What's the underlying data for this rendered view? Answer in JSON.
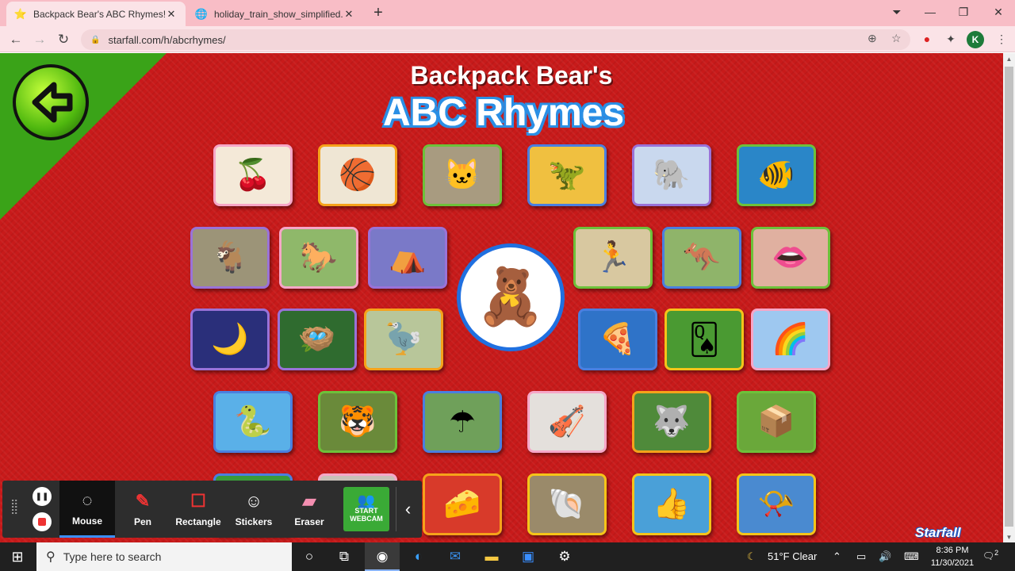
{
  "browser": {
    "tabs": [
      {
        "title": "Backpack Bear's ABC Rhymes!",
        "favicon": "star-icon",
        "active": true
      },
      {
        "title": "holiday_train_show_simplified.pd",
        "favicon": "globe-icon",
        "active": false
      }
    ],
    "url": "starfall.com/h/abcrhymes/",
    "profile_initial": "K"
  },
  "page": {
    "title_line1": "Backpack Bear's",
    "title_line2": "ABC Rhymes",
    "brand": "Starfall",
    "tiles": [
      {
        "name": "apples",
        "glyph": "🍒"
      },
      {
        "name": "ball",
        "glyph": "🏀"
      },
      {
        "name": "cat",
        "glyph": "🐱"
      },
      {
        "name": "dinosaur",
        "glyph": "🦖"
      },
      {
        "name": "elephant",
        "glyph": "🐘"
      },
      {
        "name": "fish",
        "glyph": "🐠"
      },
      {
        "name": "goat",
        "glyph": "🐐"
      },
      {
        "name": "horse",
        "glyph": "🐎"
      },
      {
        "name": "igloo",
        "glyph": "⛺"
      },
      {
        "name": "jump-rope",
        "glyph": "🏃"
      },
      {
        "name": "kangaroo",
        "glyph": "🦘"
      },
      {
        "name": "lips",
        "glyph": "👄"
      },
      {
        "name": "moon",
        "glyph": "🌙"
      },
      {
        "name": "nest",
        "glyph": "🪺"
      },
      {
        "name": "ostrich",
        "glyph": "🦤"
      },
      {
        "name": "pizza",
        "glyph": "🍕"
      },
      {
        "name": "queen",
        "glyph": "🂭"
      },
      {
        "name": "rainbow",
        "glyph": "🌈"
      },
      {
        "name": "snake",
        "glyph": "🐍"
      },
      {
        "name": "tiger",
        "glyph": "🐯"
      },
      {
        "name": "umbrella",
        "glyph": "☂"
      },
      {
        "name": "violin",
        "glyph": "🎻"
      },
      {
        "name": "wolf",
        "glyph": "🐺"
      },
      {
        "name": "box",
        "glyph": "📦"
      },
      {
        "name": "partial-1",
        "glyph": ""
      },
      {
        "name": "partial-2",
        "glyph": ""
      },
      {
        "name": "cheese",
        "glyph": "🧀"
      },
      {
        "name": "shell",
        "glyph": "🐚"
      },
      {
        "name": "thumb",
        "glyph": "👍"
      },
      {
        "name": "whistle",
        "glyph": "📯"
      }
    ],
    "center_glyph": "🧸"
  },
  "recorder": {
    "tools": [
      {
        "label": "Mouse",
        "icon": "cursor-icon",
        "active": true
      },
      {
        "label": "Pen",
        "icon": "pen-icon",
        "active": false
      },
      {
        "label": "Rectangle",
        "icon": "rectangle-icon",
        "active": false
      },
      {
        "label": "Stickers",
        "icon": "sticker-icon",
        "active": false
      },
      {
        "label": "Eraser",
        "icon": "eraser-icon",
        "active": false
      }
    ],
    "webcam_label": "START WEBCAM"
  },
  "taskbar": {
    "search_placeholder": "Type here to search",
    "weather": "51°F  Clear",
    "time": "8:36 PM",
    "date": "11/30/2021",
    "notifications": "2"
  },
  "colors": {
    "page_bg": "#c81a1a",
    "corner_green": "#3aa318",
    "tab_strip": "#f8bdc6"
  }
}
